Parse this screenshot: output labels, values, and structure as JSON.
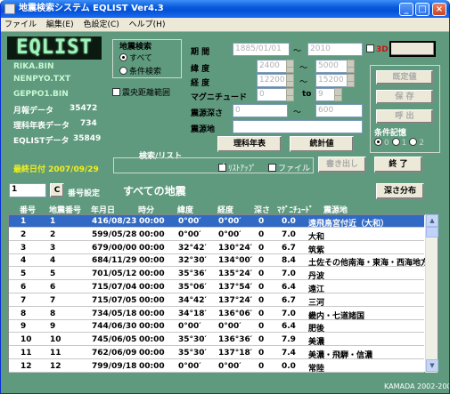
{
  "title": "地震検索システム EQLIST Ver4.3",
  "title_buttons": {
    "min": "_",
    "max": "□",
    "close": "×"
  },
  "menu": [
    "ファイル",
    "編集(E)",
    "色設定(C)",
    "ヘルプ(H)"
  ],
  "logo": "EQLIST",
  "files": [
    "RIKA.BIN",
    "NENPYO.TXT",
    "GEPPO1.BIN"
  ],
  "stats": [
    {
      "label": "月報データ",
      "value": "35472"
    },
    {
      "label": "理科年表データ",
      "value": "734"
    },
    {
      "label": "EQLISTデータ",
      "value": "35849"
    }
  ],
  "last_date": "最終日付 2007/09/29",
  "search": {
    "group_label": "地震検索",
    "all_label": "すべて",
    "cond_label": "条件検索",
    "epi_label": "震央距離範囲"
  },
  "form": {
    "period_label": "期  間",
    "period_from": "1885/01/01",
    "period_to": "2010",
    "threeD_label": "3D",
    "map_button": "地  図",
    "lat_label": "緯  度",
    "lat_from": "2400",
    "lat_to": "5000",
    "lon_label": "経  度",
    "lon_from": "12200",
    "lon_to": "15200",
    "mag_label": "マグニチュード",
    "mag_from": "0",
    "mag_to_label": "to",
    "mag_to": "9",
    "depth_label": "震源深さ",
    "depth_from": "0",
    "depth_to": "600",
    "epicenter_label": "震源地",
    "tilde": "～"
  },
  "buttons": {
    "rika": "理科年表",
    "stats": "統計値",
    "default": "既定値",
    "save": "保  存",
    "load": "呼  出",
    "write": "書き出し",
    "end": "終  了",
    "depth_dist": "深さ分布"
  },
  "cond_memory": {
    "label": "条件記憶",
    "options": [
      "0",
      "1",
      "2"
    ]
  },
  "search_list_label": "検索/リスト",
  "list_up_label": "ﾘｽﾄｱｯﾌﾟ",
  "file_label": "ファイル",
  "number_value": "1",
  "c_button": "C",
  "number_setting_label": "番号設定",
  "list_title": "すべての地震",
  "columns": [
    "番号",
    "地震番号",
    "年月日",
    "時分",
    "緯度",
    "経度",
    "深さ",
    "ﾏｸﾞﾆﾁｭｰﾄﾞ",
    "震源地"
  ],
  "rows": [
    [
      "1",
      "1",
      "416/08/23",
      "00:00",
      "0°00′",
      "0°00′",
      "0",
      "0.0",
      "遠飛鳥宮付近（大和）"
    ],
    [
      "2",
      "2",
      "599/05/28",
      "00:00",
      "0°00′",
      "0°00′",
      "0",
      "7.0",
      "大和"
    ],
    [
      "3",
      "3",
      "679/00/00",
      "00:00",
      "32°42′",
      "130°24′",
      "0",
      "6.7",
      "筑紫"
    ],
    [
      "4",
      "4",
      "684/11/29",
      "00:00",
      "32°30′",
      "134°00′",
      "0",
      "8.4",
      "土佐その他南海・東海・西海地方"
    ],
    [
      "5",
      "5",
      "701/05/12",
      "00:00",
      "35°36′",
      "135°24′",
      "0",
      "7.0",
      "丹波"
    ],
    [
      "6",
      "6",
      "715/07/04",
      "00:00",
      "35°06′",
      "137°54′",
      "0",
      "6.4",
      "遠江"
    ],
    [
      "7",
      "7",
      "715/07/05",
      "00:00",
      "34°42′",
      "137°24′",
      "0",
      "6.7",
      "三河"
    ],
    [
      "8",
      "8",
      "734/05/18",
      "00:00",
      "34°18′",
      "136°06′",
      "0",
      "7.0",
      "畿内・七道諸国"
    ],
    [
      "9",
      "9",
      "744/06/30",
      "00:00",
      "0°00′",
      "0°00′",
      "0",
      "6.4",
      "肥後"
    ],
    [
      "10",
      "10",
      "745/06/05",
      "00:00",
      "35°30′",
      "136°36′",
      "0",
      "7.9",
      "美濃"
    ],
    [
      "11",
      "11",
      "762/06/09",
      "00:00",
      "35°30′",
      "137°18′",
      "0",
      "7.4",
      "美濃・飛騨・信濃"
    ],
    [
      "12",
      "12",
      "799/09/18",
      "00:00",
      "0°00′",
      "0°00′",
      "0",
      "0.0",
      "常陸"
    ]
  ],
  "footer": "KAMADA 2002-2004",
  "colors": {
    "background": "#5f9a7e",
    "selected_row": "#316ac5",
    "logo_text": "#9df5b8",
    "date_text": "#f3f01a"
  }
}
